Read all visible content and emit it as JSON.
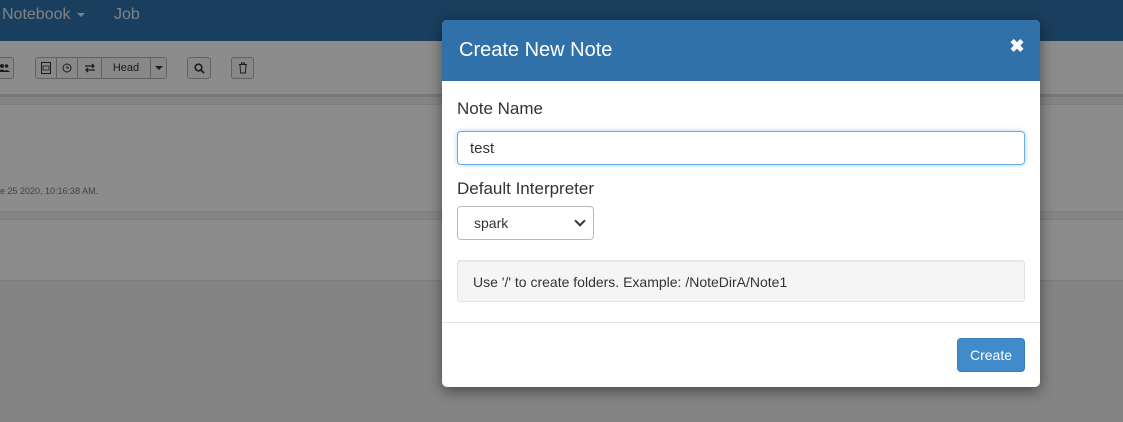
{
  "navbar": {
    "items": [
      {
        "label": "Notebook"
      },
      {
        "label": "Job"
      }
    ]
  },
  "toolbar": {
    "branch_label": "Head"
  },
  "paragraph": {
    "footer_text": "e 25 2020, 10:16:38 AM."
  },
  "modal": {
    "title": "Create New Note",
    "close_icon": "close-icon",
    "note_name_label": "Note Name",
    "note_name_value": "test",
    "interpreter_label": "Default Interpreter",
    "interpreter_selected": "spark",
    "hint_text": "Use '/' to create folders. Example: /NoteDirA/Note1",
    "create_label": "Create"
  },
  "colors": {
    "navbar": "#3071a9",
    "modal_header": "#3071a9",
    "primary_button": "#428bca",
    "input_focus": "#66afe9"
  }
}
